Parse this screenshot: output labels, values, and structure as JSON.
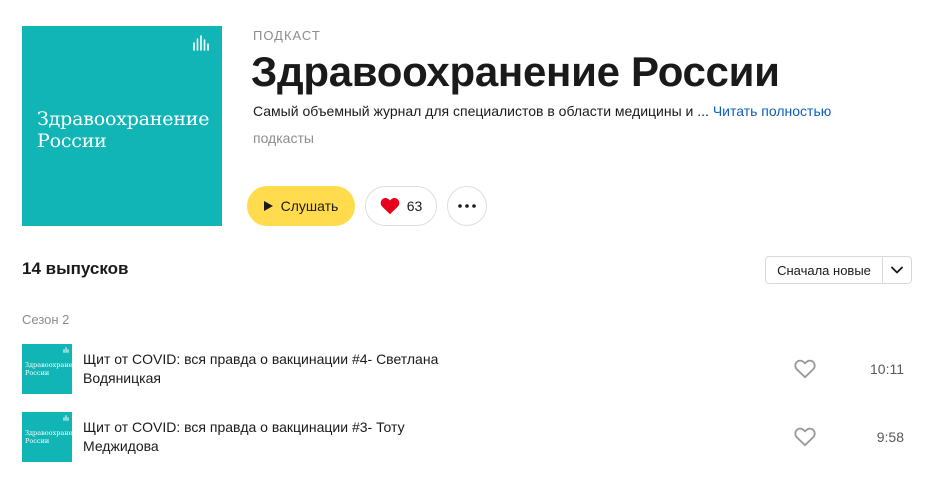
{
  "podcast": {
    "cover_title_line1": "Здравоохранение",
    "cover_title_line2": "России",
    "cover_logo_icon": "anchor-waves-icon",
    "kicker": "ПОДКАСТ",
    "title": "Здравоохранение России",
    "description": "Самый объемный журнал для специалистов в области медицины и ...",
    "read_more": "Читать полностью",
    "category": "подкасты"
  },
  "actions": {
    "listen_label": "Слушать",
    "like_count": "63",
    "more_icon": "more-dots-icon"
  },
  "episodes": {
    "count_label": "14 выпусков",
    "sort_label": "Сначала новые",
    "season_label": "Сезон 2",
    "items": [
      {
        "thumb_line1": "Здравоохранение",
        "thumb_line2": "России",
        "title": "Щит от COVID: вся правда о вакцинации #4- Светлана Водяницкая",
        "duration": "10:11"
      },
      {
        "thumb_line1": "Здравоохранение",
        "thumb_line2": "России",
        "title": "Щит от COVID: вся правда о вакцинации #3- Тоту Меджидова",
        "duration": "9:58"
      }
    ]
  },
  "colors": {
    "cover_bg": "#12b5b5",
    "listen_button": "#ffdb4d",
    "heart": "#e8001c",
    "link": "#0d5ec2"
  }
}
